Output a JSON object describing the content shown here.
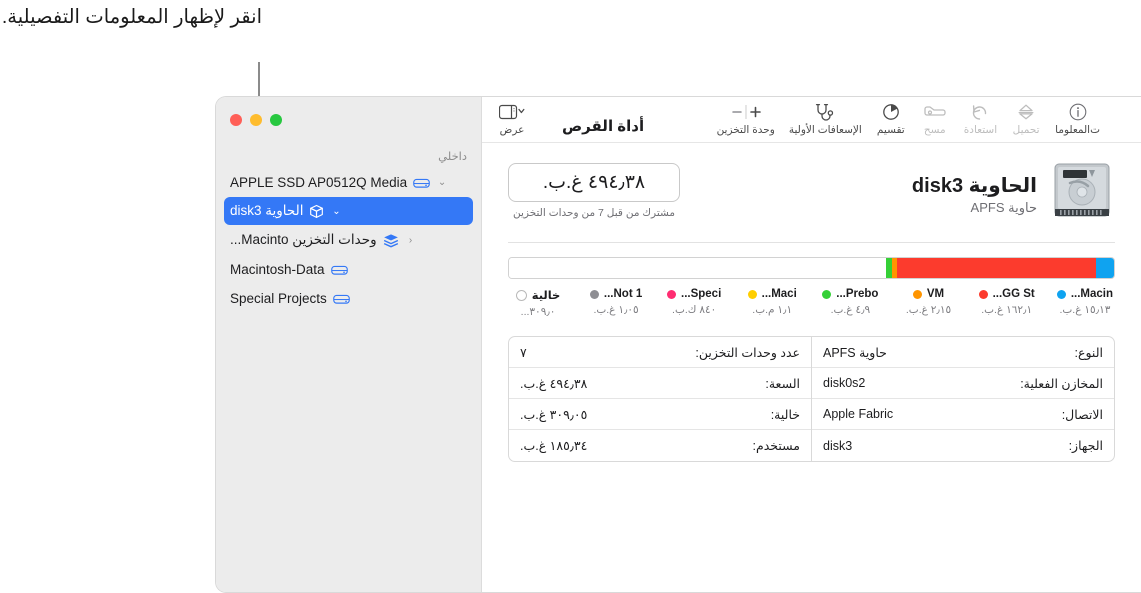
{
  "callout": {
    "text": "انقر لإظهار المعلومات التفصيلية."
  },
  "window": {
    "title": "أداة القرص"
  },
  "view_button": {
    "label": "عرض"
  },
  "toolbar": {
    "items": [
      {
        "name": "storage-unit",
        "label": "وحدة التخزين",
        "icon": "plus-minus-icon",
        "disabled": false
      },
      {
        "name": "first-aid",
        "label": "الإسعافات الأولية",
        "icon": "stethoscope-icon",
        "disabled": false
      },
      {
        "name": "partition",
        "label": "تقسيم",
        "icon": "pie-chart-icon",
        "disabled": false
      },
      {
        "name": "erase",
        "label": "مسح",
        "icon": "erase-disk-icon",
        "disabled": true
      },
      {
        "name": "restore",
        "label": "استعادة",
        "icon": "restore-arrow-icon",
        "disabled": true
      },
      {
        "name": "mount",
        "label": "تحميل",
        "icon": "eject-mount-icon",
        "disabled": true
      },
      {
        "name": "info",
        "label": "ت‌المعلوما",
        "icon": "info-icon",
        "disabled": false
      }
    ]
  },
  "sidebar": {
    "section_title": "داخلي",
    "items": [
      {
        "label": "APPLE SSD AP0512Q Media",
        "icon": "external-drive-icon",
        "chevron": "⌄",
        "indent": 0,
        "selected": false
      },
      {
        "label": "الحاوية disk3",
        "icon": "container-box-icon",
        "chevron": "⌄",
        "indent": 0,
        "selected": true
      },
      {
        "label": "وحدات التخزين Macinto...",
        "icon": "volume-group-icon",
        "chevron": "‹",
        "indent": 1,
        "selected": false
      },
      {
        "label": "Macintosh-Data",
        "icon": "volume-icon",
        "chevron": "",
        "indent": 2,
        "selected": false
      },
      {
        "label": "Special Projects",
        "icon": "volume-icon",
        "chevron": "",
        "indent": 2,
        "selected": false
      }
    ]
  },
  "disk": {
    "title": "الحاوية disk3",
    "subtitle": "حاوية APFS",
    "capacity": "٤٩٤٫٣٨ غ.ب.",
    "capacity_note": "مشترك من قبل 7 من وحدات التخزين"
  },
  "chart_data": {
    "type": "bar",
    "title": "",
    "orientation": "horizontal-stacked-rtl",
    "total_label": "٤٩٤٫٣٨ غ.ب.",
    "total_gb": 494.38,
    "unit": "GB",
    "categories": [
      "...Macin",
      "...GG St",
      "VM",
      "...Prebo",
      "...Maci",
      "...Speci",
      "...Not 1",
      "خالية"
    ],
    "values": [
      15.13,
      162.1,
      2.15,
      4.9,
      0.0011,
      0.00084,
      1.05,
      309.05
    ],
    "value_labels": [
      "١٥٫١٣ غ.ب.",
      "١٦٢٫١ غ.ب.",
      "٢٫١٥ غ.ب.",
      "٤٫٩ غ.ب.",
      "١٫١ م.ب.",
      "٨٤٠ ك.ب.",
      "١٫٠٥ غ.ب.",
      "٣٠٩٫٠..."
    ],
    "colors": [
      "#0fa3f0",
      "#fc3b2d",
      "#ff9500",
      "#35d037",
      "#ffce00",
      "#ff2d72",
      "#8e8e93",
      "#ffffff"
    ],
    "legend": [
      {
        "name": "...Macin",
        "value": "١٥٫١٣ غ.ب.",
        "color": "#0fa3f0",
        "hollow": false
      },
      {
        "name": "...GG St",
        "value": "١٦٢٫١ غ.ب.",
        "color": "#fc3b2d",
        "hollow": false
      },
      {
        "name": "VM",
        "value": "٢٫١٥ غ.ب.",
        "color": "#ff9500",
        "hollow": false
      },
      {
        "name": "...Prebo",
        "value": "٤٫٩ غ.ب.",
        "color": "#35d037",
        "hollow": false
      },
      {
        "name": "...Maci",
        "value": "١٫١ م.ب.",
        "color": "#ffce00",
        "hollow": false
      },
      {
        "name": "...Speci",
        "value": "٨٤٠ ك.ب.",
        "color": "#ff2d72",
        "hollow": false
      },
      {
        "name": "...Not 1",
        "value": "١٫٠٥ غ.ب.",
        "color": "#8e8e93",
        "hollow": false
      },
      {
        "name": "خالية",
        "value": "٣٠٩٫٠...",
        "color": "#ffffff",
        "hollow": true
      }
    ],
    "segments": [
      {
        "name": "...Macin",
        "color": "#0fa3f0",
        "percent": 3.06
      },
      {
        "name": "...GG St",
        "color": "#fc3b2d",
        "percent": 32.8
      },
      {
        "name": "VM",
        "color": "#ff9500",
        "percent": 0.9
      },
      {
        "name": "...Prebo",
        "color": "#35d037",
        "percent": 1.0
      },
      {
        "name": "خالية",
        "color": "#ffffff",
        "percent": 62.24
      }
    ],
    "legend_position": "below",
    "grid": false
  },
  "info": {
    "right_column": [
      {
        "key": "عدد وحدات التخزين:",
        "value": "٧"
      },
      {
        "key": "السعة:",
        "value": "٤٩٤٫٣٨ غ.ب."
      },
      {
        "key": "خالية:",
        "value": "٣٠٩٫٠٥ غ.ب."
      },
      {
        "key": "مستخدم:",
        "value": "١٨٥٫٣٤ غ.ب."
      }
    ],
    "left_column": [
      {
        "key": "النوع:",
        "value": "حاوية APFS"
      },
      {
        "key": "المخازن الفعلية:",
        "value": "disk0s2"
      },
      {
        "key": "الاتصال:",
        "value": "Apple Fabric"
      },
      {
        "key": "الجهاز:",
        "value": "disk3"
      }
    ]
  }
}
